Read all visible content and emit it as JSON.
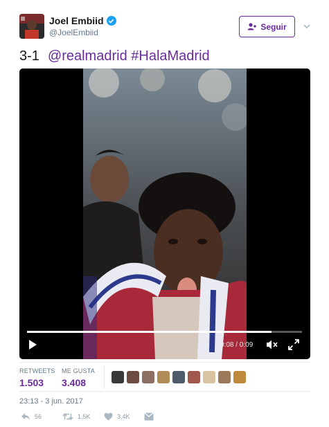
{
  "header": {
    "user_name": "Joel Embiid",
    "user_handle": "@JoelEmbiid",
    "verified_icon": "verified-check-icon",
    "follow_label": "Seguir",
    "follow_icon": "add-person-icon",
    "menu_icon": "chevron-down-icon"
  },
  "tweet": {
    "score": "3-1",
    "mention": "@realmadrid",
    "hashtag": "#HalaMadrid"
  },
  "video": {
    "time_display": "0:08 / 0:09",
    "progress": 0.89,
    "play_icon": "play-icon",
    "mute_icon": "volume-muted-icon",
    "fullscreen_icon": "fullscreen-icon"
  },
  "stats": {
    "retweets_label": "RETWEETS",
    "retweets_value": "1.503",
    "likes_label": "ME GUSTA",
    "likes_value": "3.408",
    "liker_avatar_colors": [
      "#3a3a3a",
      "#6d4c41",
      "#8d6e63",
      "#b08d57",
      "#4e5b6b",
      "#a1584b",
      "#d8c4a0",
      "#9a7a5a",
      "#c08a3e"
    ]
  },
  "timestamp": "23:13 - 3 jun. 2017",
  "actions": {
    "reply_count": "56",
    "retweet_count": "1,5K",
    "like_count": "3,4K",
    "reply_icon": "reply-icon",
    "retweet_icon": "retweet-icon",
    "like_icon": "heart-icon",
    "dm_icon": "direct-message-icon"
  },
  "colors": {
    "accent": "#6a2b9e",
    "verified": "#1da1f2",
    "muted_text": "#657786"
  }
}
